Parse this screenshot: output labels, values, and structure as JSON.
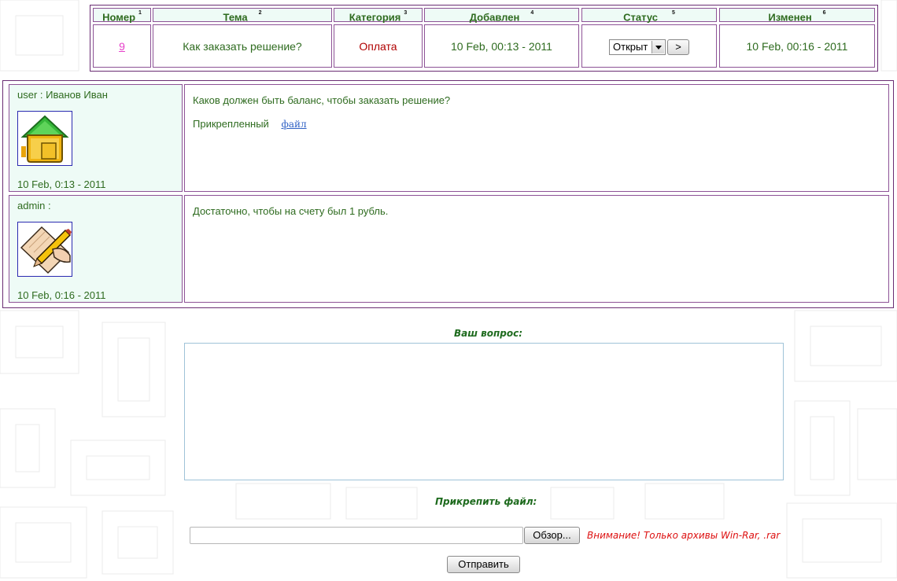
{
  "ticket": {
    "headers": [
      {
        "label": "Номер",
        "sort": "1"
      },
      {
        "label": "Тема",
        "sort": "2"
      },
      {
        "label": "Категория",
        "sort": "3"
      },
      {
        "label": "Добавлен",
        "sort": "4"
      },
      {
        "label": "Статус",
        "sort": "5"
      },
      {
        "label": "Изменен",
        "sort": "6"
      }
    ],
    "number": "9",
    "subject": "Как заказать решение?",
    "category": "Оплата",
    "added": "10 Feb, 00:13 - 2011",
    "status": "Открыт",
    "status_go": ">",
    "changed": "10 Feb, 00:16 - 2011"
  },
  "messages": [
    {
      "author": "user : Иванов Иван",
      "avatar_icon": "house-icon",
      "date": "10 Feb, 0:13 - 2011",
      "text": "Каков должен быть баланс, чтобы заказать решение?",
      "attachment_label": "Прикрепленный",
      "attachment_link": "файл"
    },
    {
      "author": "admin :",
      "avatar_icon": "pencil-paper-icon",
      "date": "10 Feb, 0:16 - 2011",
      "text": "Достаточно, чтобы на счету был 1 рубль."
    }
  ],
  "form": {
    "question_label": "Ваш вопрос:",
    "question_value": "",
    "attach_label": "Прикрепить файл:",
    "browse_label": "Обзор...",
    "warning": "Внимание! Только архивы Win-Rar, .rar",
    "submit_label": "Отправить"
  },
  "colors": {
    "text_green": "#2e6b1f",
    "border_purple": "#6a2d73",
    "header_bg": "#eefbf6",
    "link_pink": "#e63ec9",
    "category_red": "#b00000",
    "warning_red": "#dd1111"
  }
}
